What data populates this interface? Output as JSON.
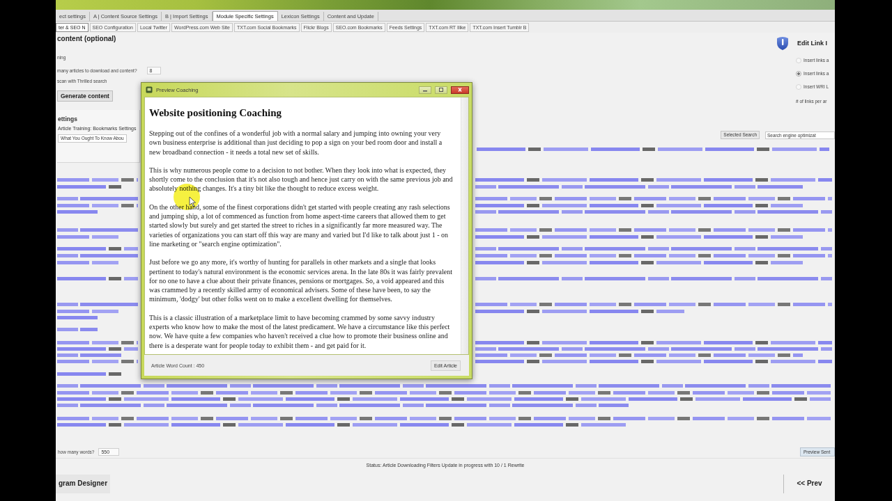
{
  "tabs": [
    {
      "label": "ect settings",
      "selected": false
    },
    {
      "label": "A | Content Source Settings",
      "selected": false
    },
    {
      "label": "B | Import Settings",
      "selected": false
    },
    {
      "label": "Module Specific Settings",
      "selected": true
    },
    {
      "label": "Lexicon Settings",
      "selected": false
    },
    {
      "label": "Content and Update",
      "selected": false
    }
  ],
  "subtabs": [
    {
      "label": "ter & SEO N",
      "selected": true
    },
    {
      "label": "SEO Configuration",
      "selected": false
    },
    {
      "label": "Local Twitter",
      "selected": false
    },
    {
      "label": "WordPress.com Web Site",
      "selected": false
    },
    {
      "label": "TXT.com Social Bookmarks",
      "selected": false
    },
    {
      "label": "Flickr Blogs",
      "selected": false
    },
    {
      "label": "SEO.com Bookmarks",
      "selected": false
    },
    {
      "label": "Feeds Settings",
      "selected": false
    },
    {
      "label": "TXT.com RT Ilike",
      "selected": false
    },
    {
      "label": "TXT.com Insert Tumblr B",
      "selected": false
    }
  ],
  "content_section": {
    "title": "content (optional)",
    "hint": "ning",
    "articles_question": "many articles to download and content?",
    "articles_value": "8",
    "scan_label": "scan with Thrilled search",
    "generate_button": "Generate content"
  },
  "settings_section": {
    "title": "ettings",
    "caption": "Article Training: Bookmarks Settings",
    "field_value": "What You Ought To Know Abou"
  },
  "link_panel": {
    "title": "Edit Link I",
    "options": [
      {
        "label": "Insert links a",
        "selected": false
      },
      {
        "label": "Insert links a",
        "selected": true
      },
      {
        "label": "Insert WRI L",
        "selected": false
      }
    ],
    "note": "# of links per ar"
  },
  "search_controls": {
    "button": "Selected Search",
    "field_value": "Search engine optimizat"
  },
  "dialog": {
    "title": "Preview Coaching",
    "heading": "Website positioning Coaching",
    "paragraphs": [
      "Stepping out of the confines of a wonderful job with a normal salary and jumping into owning your very own business enterprise is additional than just deciding to pop a sign on your bed room door and install a new broadband connection - it needs a total new set of skills.",
      "This is why numerous people come to a decision to not bother. When they look into what is expected, they shortly come to the conclusion that it's not also tough and hence just carry on with the same previous job and absolutely nothing changes. It's a tiny bit like the thought to reduce excess weight.",
      "On the other hand, some of the finest corporations didn't get started with people creating any rash selections and jumping ship, a lot of commenced as function from home aspect-time careers that allowed them to get started slowly but surely and get started the street to riches in a significantly far more measured way. The varieties of organizations you can start off this way are many and varied but I'd like to talk about just 1 - on line marketing or \"search engine optimization\".",
      "Just before we go any more, it's worthy of hunting for parallels in other markets and a single that looks pertinent to today's natural environment is the economic services arena. In the late 80s it was fairly prevalent for no one to have a clue about their private finances, pensions or mortgages. So, a void appeared and this was crammed by a recently skilled army of economical advisers. Some of these have been, to say the minimum, 'dodgy' but other folks went on to make a excellent dwelling for themselves.",
      "This is a classic illustration of a marketplace limit to have becoming crammed by some savvy industry experts who know how to make the most of the latest predicament. We have a circumstance like this perfect now. We have quite a few companies who haven't received a clue how to promote their business online and there is a desperate want for people today to exhibit them - and get paid for it."
    ],
    "word_count": "Article Word Count : 450",
    "button": "Edit Article"
  },
  "word_limit": {
    "label": "how many words?",
    "value": "550"
  },
  "preview_button": "Preview Sent",
  "status": "Status: Article Downloading Filters Update in progress with 10 / 1 Rewrite",
  "designer_button": "gram Designer",
  "prev_button": "<< Prev"
}
